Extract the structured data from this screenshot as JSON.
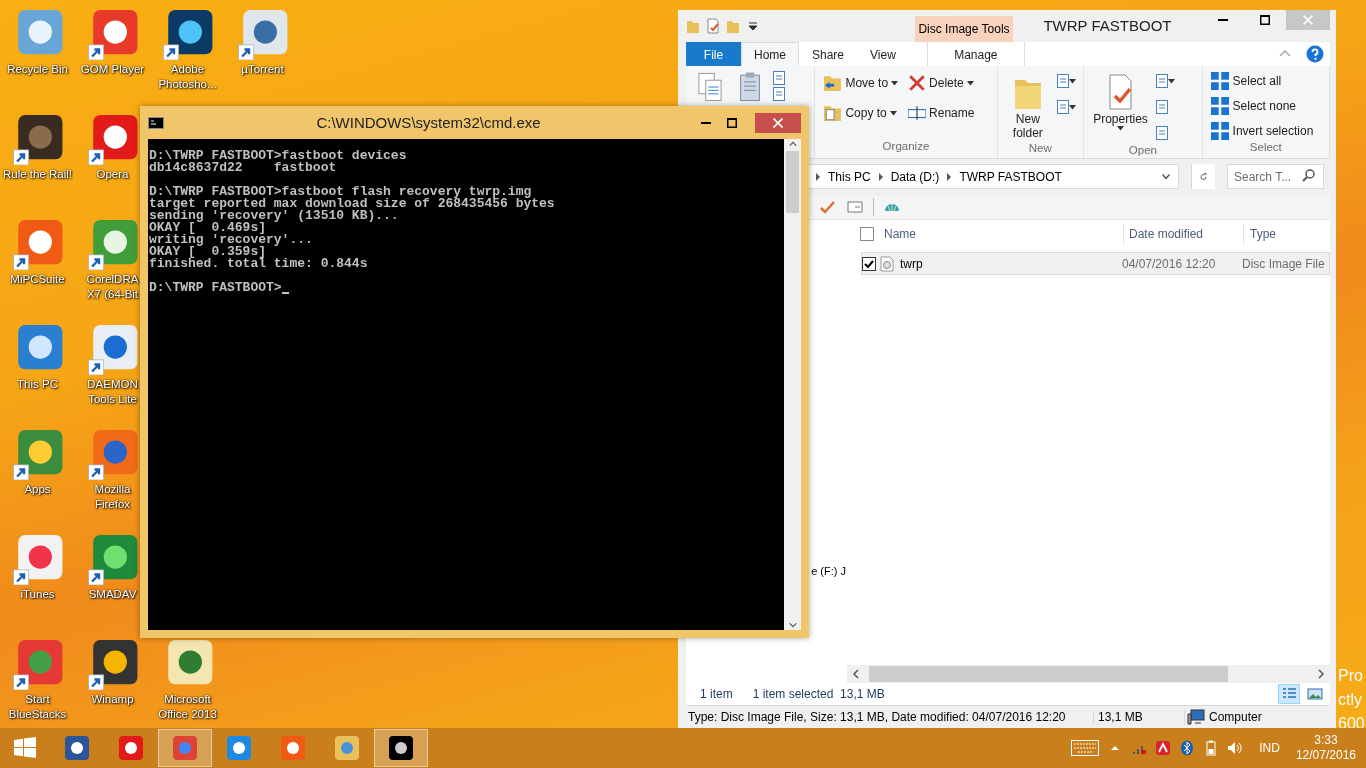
{
  "desktop": {
    "icon_rows": [
      [
        {
          "label": "Recycle Bin",
          "shortcut": false
        },
        {
          "label": "GOM Player",
          "shortcut": true
        },
        {
          "label": "Adobe Photosho...",
          "shortcut": true
        },
        {
          "label": "µTorrent",
          "shortcut": true
        }
      ],
      [
        {
          "label": "Rule the Rail!",
          "shortcut": true
        },
        {
          "label": "Opera",
          "shortcut": true
        }
      ],
      [
        {
          "label": "MiPCSuite",
          "shortcut": true
        },
        {
          "label": "CorelDRA X7 (64-Bit",
          "shortcut": true
        }
      ],
      [
        {
          "label": "This PC",
          "shortcut": false
        },
        {
          "label": "DAEMON Tools Lite",
          "shortcut": true
        }
      ],
      [
        {
          "label": "Apps",
          "shortcut": true
        },
        {
          "label": "Mozilla Firefox",
          "shortcut": true
        }
      ],
      [
        {
          "label": "iTunes",
          "shortcut": true
        },
        {
          "label": "SMADAV",
          "shortcut": true
        }
      ],
      [
        {
          "label": "Start BlueStacks",
          "shortcut": true
        },
        {
          "label": "Winamp",
          "shortcut": true
        },
        {
          "label": "Microsoft Office 2013",
          "shortcut": false
        }
      ]
    ],
    "edge_text": [
      "Pro",
      "ctly",
      "600"
    ]
  },
  "explorer": {
    "title": "TWRP FASTBOOT",
    "context_group": "Disc Image Tools",
    "tabs": [
      {
        "label": "File",
        "kind": "file",
        "selected": false
      },
      {
        "label": "Home",
        "kind": "tab",
        "selected": true
      },
      {
        "label": "Share",
        "kind": "tab",
        "selected": false
      },
      {
        "label": "View",
        "kind": "tab",
        "selected": false
      },
      {
        "label": "Manage",
        "kind": "context",
        "selected": false
      }
    ],
    "ribbon_groups": [
      {
        "commands": [
          {
            "kind": "large-icon"
          },
          {
            "kind": "large-icon"
          },
          {
            "kind": "icon"
          },
          {
            "kind": "icon"
          }
        ]
      },
      {
        "label": "Organize",
        "commands": [
          {
            "kind": "medium",
            "label": "Move to",
            "dropdown": true
          },
          {
            "kind": "medium",
            "label": "Copy to",
            "dropdown": true
          },
          {
            "kind": "medium",
            "label": "Delete",
            "dropdown": true
          },
          {
            "kind": "medium",
            "label": "Rename",
            "dropdown": false
          }
        ]
      },
      {
        "label": "New",
        "commands": [
          {
            "kind": "large",
            "label": "New folder",
            "dropdown": false
          },
          {
            "kind": "icon",
            "dropdown": true
          },
          {
            "kind": "icon",
            "dropdown": true
          }
        ]
      },
      {
        "label": "Open",
        "commands": [
          {
            "kind": "large",
            "label": "Properties",
            "dropdown": true
          },
          {
            "kind": "icon",
            "dropdown": true
          },
          {
            "kind": "icon",
            "dropdown": false
          },
          {
            "kind": "icon",
            "dropdown": false
          }
        ]
      },
      {
        "label": "Select",
        "commands": [
          {
            "kind": "small",
            "label": "Select all"
          },
          {
            "kind": "small",
            "label": "Select none"
          },
          {
            "kind": "small",
            "label": "Invert selection"
          }
        ]
      }
    ],
    "breadcrumb": [
      "This PC",
      "Data (D:)",
      "TWRP FASTBOOT"
    ],
    "search": {
      "placeholder": "Search T..."
    },
    "nav_items": [
      "e (F:) J"
    ],
    "select_all": {
      "checked": false
    },
    "columns": [
      "Name",
      "Date modified",
      "Type"
    ],
    "files": [
      {
        "name": "twrp",
        "date": "04/07/2016 12:20",
        "type": "Disc Image File",
        "selected": true,
        "checked": true
      }
    ],
    "status": {
      "count": "1 item",
      "selection": "1 item selected  13,1 MB"
    },
    "details_bar": {
      "summary": "Type: Disc Image File, Size: 13,1 MB, Date modified: 04/07/2016 12:20",
      "size": "13,1 MB",
      "location": "Computer"
    }
  },
  "console": {
    "title": "C:\\WINDOWS\\system32\\cmd.exe",
    "blocks": [
      [
        "D:\\TWRP FASTBOOT>fastboot devices",
        "db14c8637d22    fastboot"
      ],
      [
        "D:\\TWRP FASTBOOT>fastboot flash recovery twrp.img",
        "target reported max download size of 268435456 bytes",
        "sending 'recovery' (13510 KB)...",
        "OKAY [  0.469s]",
        "writing 'recovery'...",
        "OKAY [  0.359s]",
        "finished. total time: 0.844s"
      ],
      [
        "D:\\TWRP FASTBOOT>"
      ]
    ]
  },
  "taskbar": {
    "apps": [
      {
        "active": false
      },
      {
        "active": false
      },
      {
        "active": true
      },
      {
        "active": false
      },
      {
        "active": false
      },
      {
        "active": false
      },
      {
        "active": true
      }
    ],
    "language": "IND",
    "time": "3:33",
    "date": "12/07/2016"
  }
}
